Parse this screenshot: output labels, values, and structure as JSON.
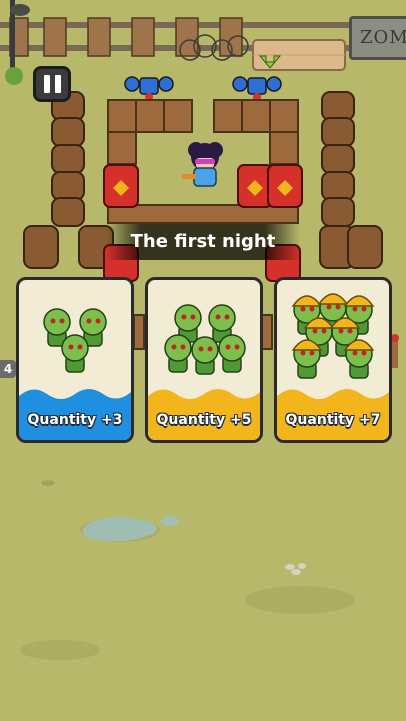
{
  "sign": {
    "text": "ZOMB"
  },
  "banner": {
    "title": "The first night"
  },
  "side_counter": "4",
  "cards": [
    {
      "label": "Quantity +3",
      "theme": "blue",
      "wave_color": "#1f8fe0",
      "zombie_type": "zombie",
      "count": 3
    },
    {
      "label": "Quantity +5",
      "theme": "yellow",
      "wave_color": "#f2b51b",
      "zombie_type": "zombie",
      "count": 5
    },
    {
      "label": "Quantity +7",
      "theme": "yellow",
      "wave_color": "#f2b51b",
      "zombie_type": "hardhat-zombie",
      "count": 7
    }
  ],
  "colors": {
    "grass": "#b7b86a",
    "barrel_red": "#d6302a",
    "crate": "#9c6a3c",
    "zombie_skin": "#7cc04b",
    "hardhat": "#f2b51b"
  }
}
